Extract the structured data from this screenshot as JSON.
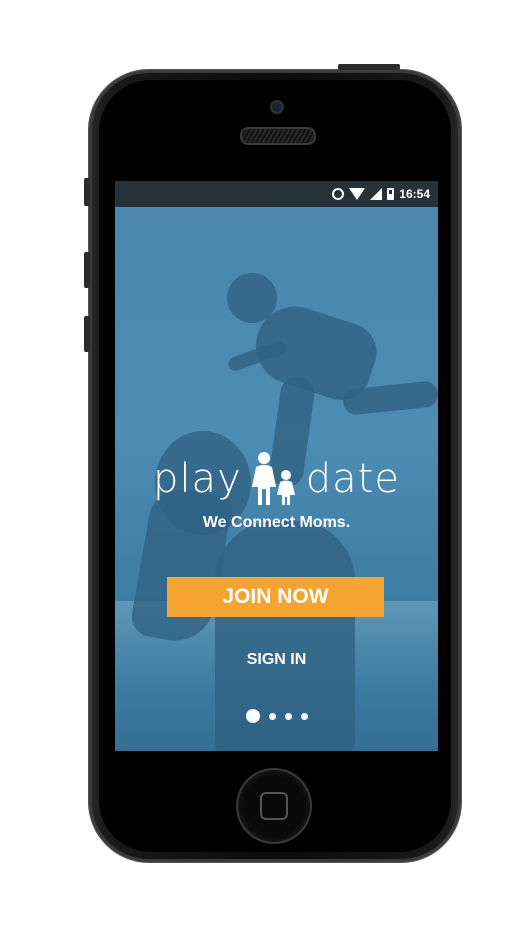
{
  "status_bar": {
    "time": "16:54",
    "icons": [
      "alarm-icon",
      "wifi-icon",
      "signal-icon",
      "battery-icon"
    ]
  },
  "brand": {
    "logo_word_left": "play",
    "logo_word_right": "date",
    "tagline": "We Connect Moms."
  },
  "actions": {
    "join_label": "JOIN NOW",
    "signin_label": "SIGN IN"
  },
  "pager": {
    "count": 4,
    "active_index": 0
  },
  "colors": {
    "accent": "#f5a432",
    "status_bar": "#263238",
    "screen_tint": "#4a86ad"
  }
}
